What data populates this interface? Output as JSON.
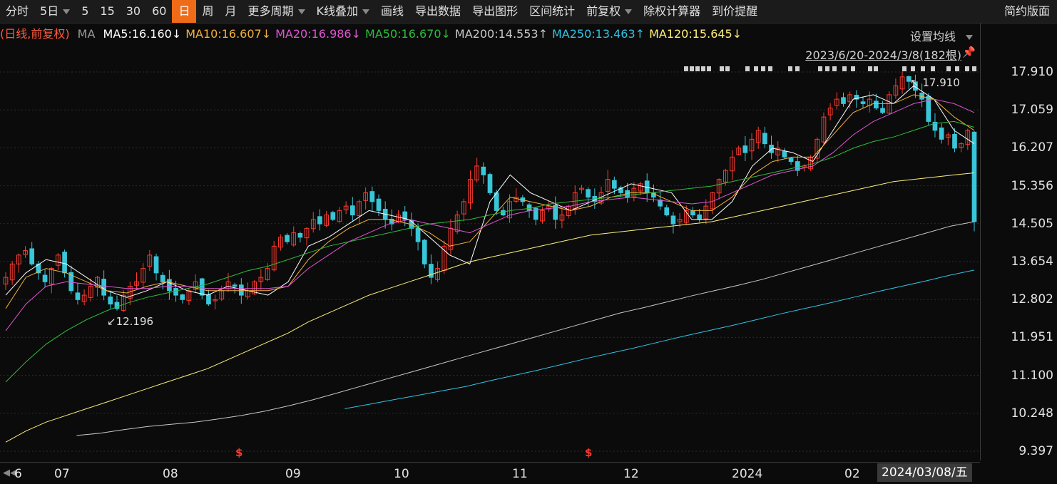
{
  "toolbar": {
    "items": [
      "分时",
      "5日",
      "5",
      "15",
      "30",
      "60",
      "日",
      "周",
      "月",
      "更多周期",
      "K线叠加",
      "画线",
      "导出数据",
      "导出图形",
      "区间统计",
      "前复权",
      "除权计算器",
      "到价提醒"
    ],
    "active_index": 6,
    "dropdown_indices": [
      1,
      9,
      10,
      15
    ],
    "right_label": "简约版面"
  },
  "ma_legend": {
    "prefix": "(日线,前复权)",
    "ma": "MA",
    "items": [
      {
        "text": "MA5:16.160↓",
        "color": "#ffffff"
      },
      {
        "text": "MA10:16.607↓",
        "color": "#f3b13a"
      },
      {
        "text": "MA20:16.986↓",
        "color": "#e055d4"
      },
      {
        "text": "MA50:16.670↓",
        "color": "#2ebd3b"
      },
      {
        "text": "MA200:14.553↑",
        "color": "#c8c8c8"
      },
      {
        "text": "MA250:13.463↑",
        "color": "#2fc4e3"
      },
      {
        "text": "MA120:15.645↓",
        "color": "#fff07a"
      }
    ],
    "prefix_color": "#ff5a3c",
    "ma_color": "#9a9a9a"
  },
  "settings_label": "设置均线",
  "range_label": "2023/6/20-2024/3/8(182根)",
  "date_box": "2024/03/08/五",
  "dividend_marker": "$",
  "chart_data": {
    "type": "candlestick",
    "y_ticks": [
      "17.910",
      "17.059",
      "16.207",
      "15.356",
      "14.505",
      "13.654",
      "12.802",
      "11.951",
      "11.100",
      "10.248",
      "9.397"
    ],
    "ylim": [
      9.397,
      17.91
    ],
    "x_ticks": [
      "6",
      "07",
      "08",
      "09",
      "10",
      "11",
      "12",
      "2024",
      "02"
    ],
    "annotations": [
      {
        "text": "12.196",
        "kind": "low"
      },
      {
        "text": "17.910",
        "kind": "high"
      }
    ],
    "series_closes": [
      13.3,
      13.6,
      13.8,
      13.9,
      13.6,
      13.4,
      13.2,
      13.5,
      13.8,
      13.4,
      13.0,
      12.8,
      12.9,
      13.1,
      13.3,
      12.9,
      12.7,
      12.6,
      12.9,
      13.1,
      13.2,
      13.5,
      13.8,
      13.4,
      13.2,
      13.0,
      12.9,
      12.8,
      13.0,
      13.2,
      12.9,
      12.7,
      12.8,
      13.0,
      13.2,
      13.1,
      12.9,
      13.0,
      13.2,
      13.3,
      13.5,
      14.0,
      14.2,
      14.1,
      14.3,
      14.2,
      14.4,
      14.6,
      14.5,
      14.7,
      14.6,
      14.8,
      14.9,
      14.7,
      15.0,
      15.2,
      15.0,
      14.8,
      14.6,
      14.5,
      14.7,
      14.6,
      14.4,
      14.1,
      13.6,
      13.3,
      13.5,
      14.0,
      14.4,
      14.7,
      15.0,
      15.5,
      15.8,
      15.6,
      15.2,
      14.8,
      14.7,
      15.0,
      15.1,
      15.0,
      14.8,
      14.6,
      14.8,
      14.9,
      14.6,
      14.7,
      14.9,
      15.2,
      15.3,
      15.1,
      15.0,
      15.2,
      15.5,
      15.3,
      15.2,
      15.1,
      15.3,
      15.4,
      15.2,
      15.1,
      14.9,
      14.7,
      14.5,
      14.6,
      14.8,
      14.7,
      14.6,
      14.9,
      15.2,
      15.5,
      15.7,
      16.0,
      16.2,
      16.1,
      16.4,
      16.6,
      16.3,
      16.1,
      16.2,
      16.0,
      15.9,
      15.7,
      15.8,
      16.0,
      16.4,
      16.9,
      17.1,
      17.3,
      17.2,
      17.4,
      17.3,
      17.2,
      17.3,
      17.1,
      17.0,
      17.4,
      17.6,
      17.8,
      17.7,
      17.5,
      17.3,
      16.8,
      16.6,
      16.4,
      16.5,
      16.2,
      16.3,
      16.6,
      14.55
    ],
    "moving_averages": [
      {
        "name": "MA5",
        "color": "#ffffff",
        "values": [
          12.9,
          13.4,
          13.7,
          13.6,
          13.3,
          13.0,
          12.85,
          13.0,
          13.2,
          13.0,
          12.9,
          13.1,
          13.0,
          12.9,
          13.2,
          14.0,
          14.2,
          14.5,
          14.8,
          14.7,
          14.6,
          14.2,
          13.8,
          13.6,
          15.0,
          15.6,
          15.2,
          15.0,
          14.8,
          15.0,
          15.2,
          15.4,
          15.3,
          15.2,
          14.6,
          14.6,
          15.0,
          15.8,
          16.2,
          16.1,
          15.9,
          16.6,
          17.3,
          17.4,
          17.2,
          17.6,
          17.3,
          16.6,
          16.3
        ]
      },
      {
        "name": "MA10",
        "color": "#f3b13a",
        "values": [
          12.6,
          13.3,
          13.5,
          13.4,
          13.2,
          13.0,
          12.95,
          13.1,
          13.2,
          13.1,
          13.0,
          13.0,
          13.0,
          13.0,
          13.1,
          13.7,
          14.1,
          14.4,
          14.6,
          14.6,
          14.5,
          14.3,
          14.0,
          14.1,
          14.6,
          15.1,
          15.0,
          14.9,
          14.8,
          14.9,
          15.1,
          15.2,
          15.2,
          15.0,
          14.8,
          14.8,
          15.1,
          15.6,
          15.9,
          16.0,
          16.0,
          16.5,
          17.0,
          17.2,
          17.2,
          17.4,
          17.3,
          16.9,
          16.6
        ]
      },
      {
        "name": "MA20",
        "color": "#e055d4",
        "values": [
          12.1,
          12.7,
          13.1,
          13.2,
          13.15,
          13.1,
          13.05,
          13.05,
          13.1,
          13.1,
          13.05,
          13.05,
          13.05,
          13.05,
          13.1,
          13.5,
          13.8,
          14.1,
          14.3,
          14.5,
          14.6,
          14.5,
          14.4,
          14.3,
          14.5,
          14.7,
          14.8,
          14.85,
          14.9,
          15.0,
          15.05,
          15.1,
          15.05,
          15.0,
          14.95,
          15.0,
          15.2,
          15.4,
          15.6,
          15.7,
          15.8,
          16.1,
          16.5,
          16.8,
          17.0,
          17.2,
          17.3,
          17.2,
          17.0
        ]
      },
      {
        "name": "MA50",
        "color": "#2ebd3b",
        "values": [
          10.95,
          11.4,
          11.8,
          12.1,
          12.35,
          12.55,
          12.72,
          12.85,
          12.95,
          13.05,
          13.15,
          13.3,
          13.45,
          13.55,
          13.7,
          13.85,
          14.0,
          14.1,
          14.2,
          14.3,
          14.4,
          14.5,
          14.55,
          14.6,
          14.7,
          14.8,
          14.85,
          14.95,
          15.0,
          15.05,
          15.1,
          15.15,
          15.2,
          15.25,
          15.3,
          15.35,
          15.45,
          15.55,
          15.65,
          15.75,
          15.85,
          16.0,
          16.2,
          16.35,
          16.45,
          16.6,
          16.75,
          16.8,
          16.67
        ]
      },
      {
        "name": "MA120",
        "color": "#fff07a",
        "values": [
          9.6,
          9.85,
          10.05,
          10.2,
          10.35,
          10.5,
          10.65,
          10.8,
          10.95,
          11.1,
          11.25,
          11.45,
          11.65,
          11.85,
          12.05,
          12.3,
          12.5,
          12.7,
          12.9,
          13.05,
          13.2,
          13.35,
          13.5,
          13.65,
          13.75,
          13.85,
          13.95,
          14.05,
          14.15,
          14.25,
          14.3,
          14.35,
          14.4,
          14.45,
          14.5,
          14.55,
          14.65,
          14.75,
          14.85,
          14.95,
          15.05,
          15.15,
          15.25,
          15.35,
          15.45,
          15.5,
          15.55,
          15.6,
          15.645
        ]
      },
      {
        "name": "MA200",
        "color": "#c8c8c8",
        "values": [
          null,
          null,
          null,
          9.75,
          9.8,
          9.88,
          9.95,
          10.0,
          10.05,
          10.12,
          10.2,
          10.3,
          10.42,
          10.55,
          10.7,
          10.85,
          11.0,
          11.15,
          11.3,
          11.45,
          11.6,
          11.75,
          11.9,
          12.05,
          12.2,
          12.35,
          12.5,
          12.62,
          12.75,
          12.88,
          13.0,
          13.12,
          13.25,
          13.4,
          13.55,
          13.7,
          13.85,
          14.0,
          14.15,
          14.3,
          14.45,
          14.55
        ]
      },
      {
        "name": "MA250",
        "color": "#2fc4e3",
        "values": [
          null,
          null,
          null,
          null,
          null,
          null,
          null,
          null,
          null,
          null,
          null,
          null,
          null,
          null,
          10.35,
          10.45,
          10.55,
          10.65,
          10.75,
          10.85,
          10.98,
          11.1,
          11.22,
          11.35,
          11.48,
          11.6,
          11.72,
          11.85,
          11.98,
          12.1,
          12.22,
          12.35,
          12.48,
          12.6,
          12.72,
          12.85,
          12.98,
          13.1,
          13.22,
          13.35,
          13.463
        ]
      }
    ]
  }
}
